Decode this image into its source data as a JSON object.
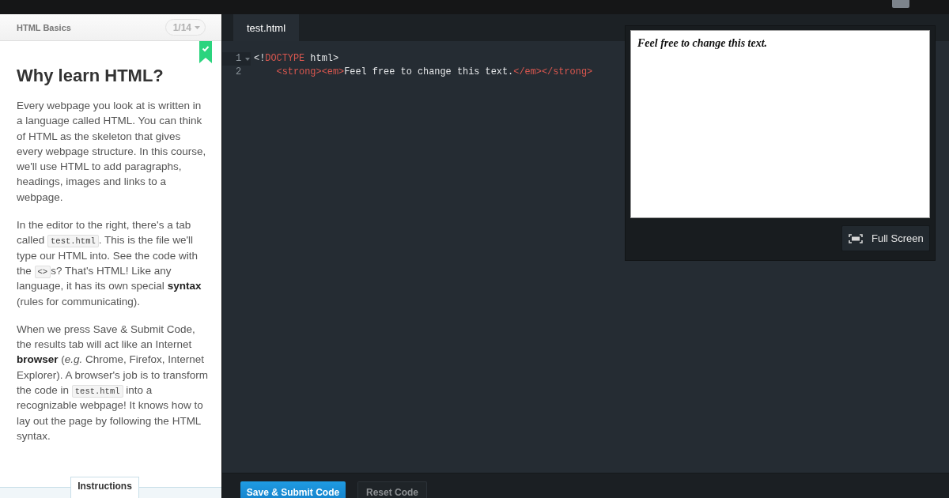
{
  "lesson_header": {
    "course": "HTML Basics",
    "progress": "1/14"
  },
  "lesson": {
    "completed": true,
    "title": "Why learn HTML?",
    "paragraphs": [
      [
        {
          "kind": "text",
          "text": "Every webpage you look at is written in a language called HTML. You can think of HTML as the skeleton that gives every webpage structure. In this course, we'll use HTML to add paragraphs, headings, images and links to a webpage."
        }
      ],
      [
        {
          "kind": "text",
          "text": "In the editor to the right, there's a tab called "
        },
        {
          "kind": "code",
          "text": "test.html"
        },
        {
          "kind": "text",
          "text": ". This is the file we'll type our HTML into. See the code with the "
        },
        {
          "kind": "code",
          "text": "<>"
        },
        {
          "kind": "text",
          "text": "s? That's HTML! Like any language, it has its own special **syntax** (rules for communicating)."
        }
      ],
      [
        {
          "kind": "text",
          "text": "When we press Save & Submit Code, the results tab will act like an Internet **browser** (*e.g.* Chrome, Firefox, Internet Explorer). A browser's job is to transform the code in "
        },
        {
          "kind": "code",
          "text": "test.html"
        },
        {
          "kind": "text",
          "text": " into a recognizable webpage! It knows how to lay out the page by following the HTML syntax."
        }
      ]
    ]
  },
  "lesson_tabs": [
    {
      "label": "Instructions",
      "selected": true
    }
  ],
  "editor": {
    "tabs": [
      {
        "label": "test.html",
        "selected": true
      }
    ],
    "lines": [
      {
        "number": "1",
        "foldable": true,
        "active": true,
        "tokens": [
          {
            "kind": "text",
            "text": "<!"
          },
          {
            "kind": "tag",
            "text": "DOCTYPE"
          },
          {
            "kind": "text",
            "text": " html>"
          }
        ]
      },
      {
        "number": "2",
        "foldable": false,
        "active": false,
        "tokens": [
          {
            "kind": "tag",
            "text": "    <strong><em>"
          },
          {
            "kind": "text",
            "text": "Feel free to change this text."
          },
          {
            "kind": "tag",
            "text": "</em></strong>"
          }
        ]
      }
    ]
  },
  "preview": {
    "text": "Feel free to change this text.",
    "fullscreen_button": "Full Screen"
  },
  "actions": [
    {
      "label": "Save & Submit Code",
      "kind": "primary"
    },
    {
      "label": "Reset Code",
      "kind": "secondary"
    }
  ]
}
